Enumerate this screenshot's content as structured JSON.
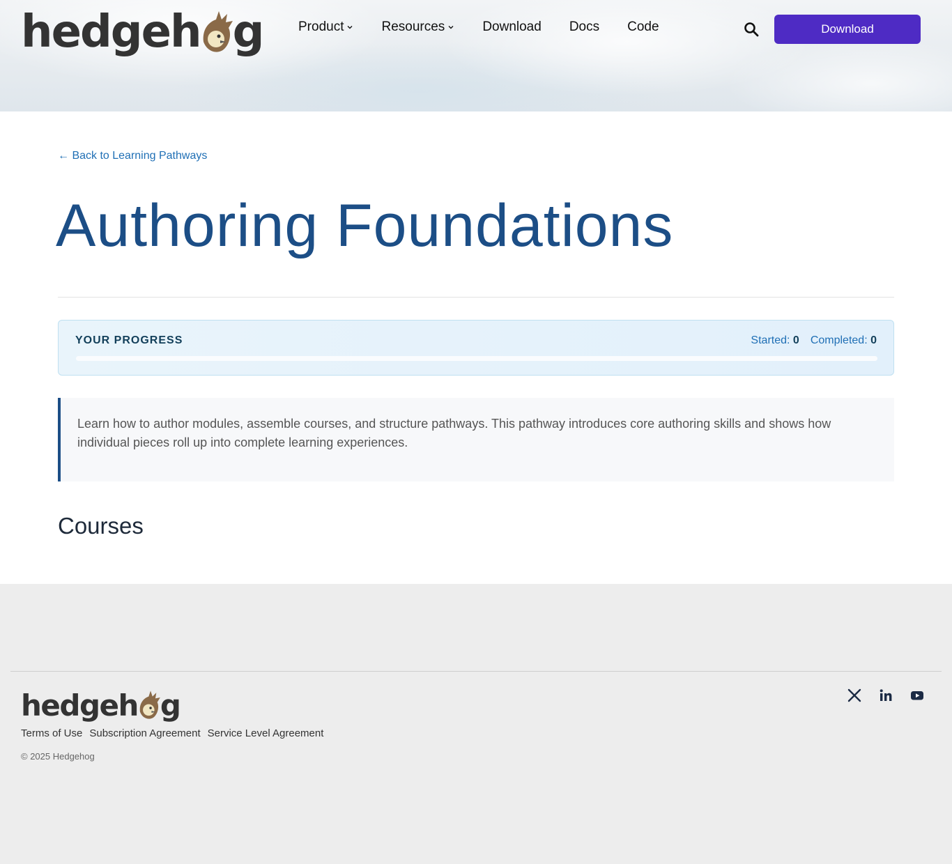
{
  "brand": {
    "name": "hedgehog",
    "prefix": "hedgeh",
    "suffix": "g"
  },
  "nav": {
    "items": [
      {
        "label": "Product",
        "has_dropdown": true
      },
      {
        "label": "Resources",
        "has_dropdown": true
      },
      {
        "label": "Download",
        "has_dropdown": false
      },
      {
        "label": "Docs",
        "has_dropdown": false
      },
      {
        "label": "Code",
        "has_dropdown": false
      }
    ],
    "search_icon": "search-icon",
    "cta_label": "Download"
  },
  "main": {
    "back_link": "← Back to Learning Pathways",
    "title": "Authoring Foundations",
    "progress": {
      "heading": "YOUR PROGRESS",
      "started_label": "Started:",
      "started_value": "0",
      "completed_label": "Completed:",
      "completed_value": "0",
      "percent": 0
    },
    "description": "Learn how to author modules, assemble courses, and structure pathways. This pathway introduces core authoring skills and shows how individual pieces roll up into complete learning experiences.",
    "courses_heading": "Courses"
  },
  "footer": {
    "links": [
      "Terms of Use",
      "Subscription Agreement",
      "Service Level Agreement"
    ],
    "copyright": "© 2025 Hedgehog",
    "social": [
      "x-icon",
      "linkedin-icon",
      "youtube-icon"
    ]
  },
  "colors": {
    "primary_purple": "#4e2bc4",
    "title_blue": "#1c4e86",
    "link_blue": "#1f6fb5",
    "logo_brown": "#8a6a48",
    "logo_dark": "#333333"
  }
}
